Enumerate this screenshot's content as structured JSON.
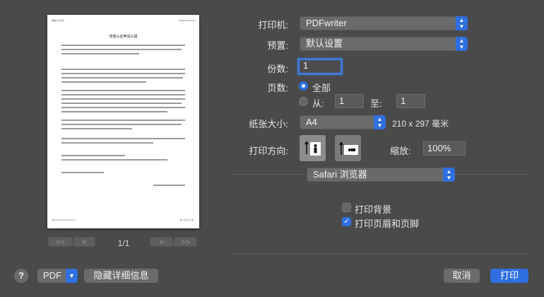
{
  "preview": {
    "doc_title": "增值认证申请公函",
    "header_left": "微信公众平台",
    "header_right": "2019/11/13 13:34",
    "footer_left": "https://mp.weixin.qq.com/...",
    "footer_right": "第 1 页 共 1 页",
    "page_indicator": "1/1",
    "first_page": "<<",
    "prev_page": "<",
    "next_page": ">",
    "last_page": ">>"
  },
  "printer": {
    "label": "打印机:",
    "value": "PDFwriter"
  },
  "preset": {
    "label": "预置:",
    "value": "默认设置"
  },
  "copies": {
    "label": "份数:",
    "value": "1"
  },
  "pages": {
    "label": "页数:",
    "all_label": "全部",
    "from_label": "从:",
    "from_value": "1",
    "to_label": "至:",
    "to_value": "1"
  },
  "paper_size": {
    "label": "纸张大小:",
    "value": "A4",
    "dimensions": "210 x 297 毫米"
  },
  "orientation": {
    "label": "打印方向:",
    "selected": "portrait"
  },
  "scale": {
    "label": "缩放:",
    "value": "100%"
  },
  "app_section": {
    "value": "Safari 浏览器"
  },
  "options": {
    "print_backgrounds": {
      "label": "打印背景",
      "checked": false
    },
    "print_headers_footers": {
      "label": "打印页眉和页脚",
      "checked": true
    }
  },
  "footer": {
    "help": "?",
    "pdf_label": "PDF",
    "hide_details": "隐藏详细信息",
    "cancel": "取消",
    "print": "打印"
  },
  "colors": {
    "accent": "#2f6fdf",
    "background": "#4a4a4a"
  }
}
